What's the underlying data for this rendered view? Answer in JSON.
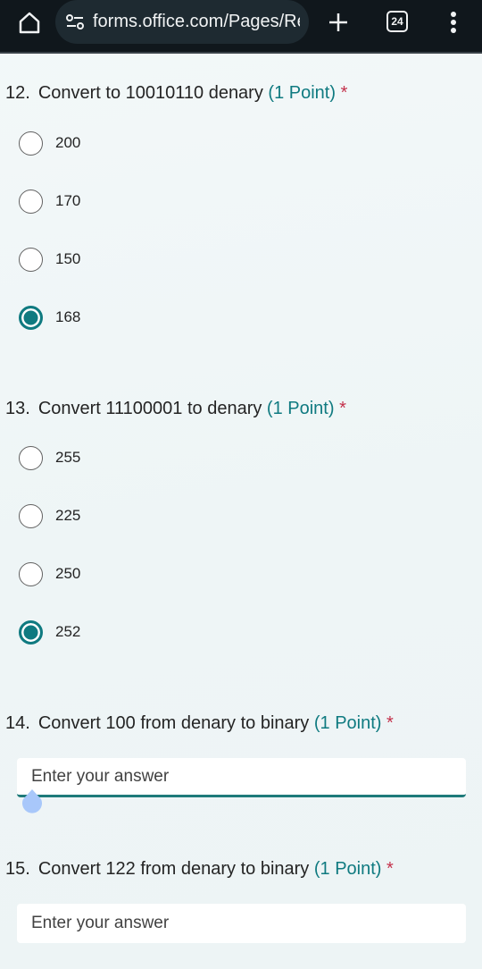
{
  "browser": {
    "url": "forms.office.com/Pages/ResponsePage",
    "tab_count": "24",
    "icons": {
      "home": "home-icon",
      "site_settings": "tune-icon",
      "new_tab": "plus-icon",
      "tabs": "tab-switcher-icon",
      "menu": "more-vert-icon"
    }
  },
  "colors": {
    "accent": "#0f7a80",
    "required": "#c4314b",
    "toolbar": "#10171c"
  },
  "questions": [
    {
      "number": "12.",
      "text": "Convert  to 10010110 denary",
      "points": "(1 Point)",
      "required_mark": "*",
      "type": "choice",
      "options": [
        {
          "label": "200",
          "selected": false
        },
        {
          "label": "170",
          "selected": false
        },
        {
          "label": "150",
          "selected": false
        },
        {
          "label": "168",
          "selected": true
        }
      ]
    },
    {
      "number": "13.",
      "text": "Convert 11100001 to denary",
      "points": "(1 Point)",
      "required_mark": "*",
      "type": "choice",
      "options": [
        {
          "label": "255",
          "selected": false
        },
        {
          "label": "225",
          "selected": false
        },
        {
          "label": "250",
          "selected": false
        },
        {
          "label": "252",
          "selected": true
        }
      ]
    },
    {
      "number": "14.",
      "text": "Convert 100 from denary to binary",
      "points": "(1 Point)",
      "required_mark": "*",
      "type": "text",
      "value": "",
      "placeholder": "Enter your answer"
    },
    {
      "number": "15.",
      "text": "Convert 122 from denary to binary",
      "points": "(1 Point)",
      "required_mark": "*",
      "type": "text",
      "value": "",
      "placeholder": "Enter your answer"
    }
  ]
}
